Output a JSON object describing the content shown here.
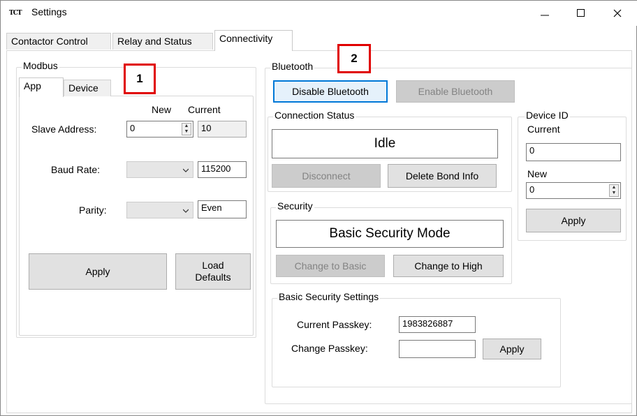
{
  "window": {
    "title": "Settings",
    "icon_text": "TCT"
  },
  "tabs": [
    "Contactor Control",
    "Relay and Status",
    "Connectivity"
  ],
  "modbus": {
    "group_label": "Modbus",
    "subtabs": [
      "App",
      "Device"
    ],
    "col_new": "New",
    "col_current": "Current",
    "slave_label": "Slave Address:",
    "slave_new": "0",
    "slave_current": "10",
    "baud_label": "Baud Rate:",
    "baud_new": "",
    "baud_current": "115200",
    "parity_label": "Parity:",
    "parity_new": "",
    "parity_current": "Even",
    "apply_label": "Apply",
    "load_defaults_line1": "Load",
    "load_defaults_line2": "Defaults"
  },
  "callouts": {
    "one": "1",
    "two": "2"
  },
  "bluetooth": {
    "group_label": "Bluetooth",
    "disable_label": "Disable Bluetooth",
    "enable_label": "Enable Bluetooth",
    "connection": {
      "group_label": "Connection Status",
      "status": "Idle",
      "disconnect_label": "Disconnect",
      "delete_bond_label": "Delete Bond Info"
    },
    "security": {
      "group_label": "Security",
      "mode": "Basic Security Mode",
      "to_basic_label": "Change to Basic",
      "to_high_label": "Change to High"
    },
    "basic_settings": {
      "group_label": "Basic Security Settings",
      "current_passkey_label": "Current Passkey:",
      "current_passkey": "1983826887",
      "change_passkey_label": "Change Passkey:",
      "change_passkey": "",
      "apply_label": "Apply"
    },
    "device_id": {
      "group_label": "Device ID",
      "current_label": "Current",
      "current_value": "0",
      "new_label": "New",
      "new_value": "0",
      "apply_label": "Apply"
    }
  },
  "colors": {
    "accent": "#0078d7",
    "callout_border": "#e00000",
    "disabled_bg": "#cccccc"
  }
}
